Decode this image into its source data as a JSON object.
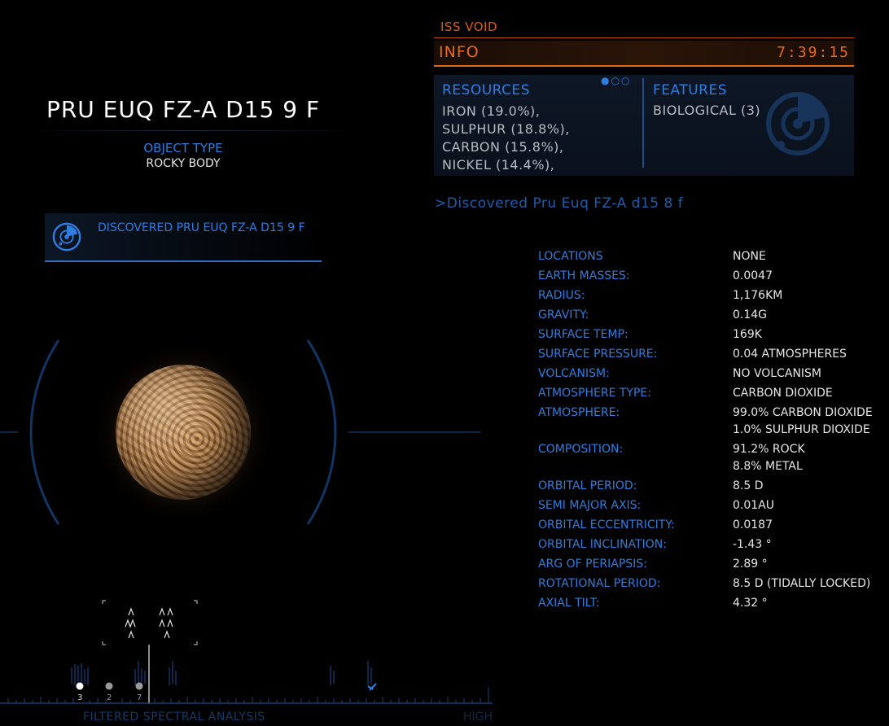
{
  "planet": {
    "name": "PRU EUQ FZ-A D15 9 F",
    "object_type_label": "OBJECT TYPE",
    "object_type_value": "ROCKY BODY"
  },
  "discovered_notice": "DISCOVERED PRU EUQ FZ-A D15 9 F",
  "spectral": {
    "label": "FILTERED SPECTRAL ANALYSIS",
    "high_label": "HIGH",
    "markers": [
      "3",
      "2",
      "7"
    ]
  },
  "header": {
    "ship": "ISS VOID",
    "title": "INFO",
    "time": "7:39:15"
  },
  "info_panel": {
    "resources_title": "RESOURCES",
    "resources": [
      "IRON (19.0%),",
      "SULPHUR (18.8%),",
      "CARBON (15.8%),",
      "NICKEL (14.4%),"
    ],
    "features_title": "FEATURES",
    "features": [
      "BIOLOGICAL (3)"
    ],
    "page_dots": "●○○"
  },
  "message": ">Discovered Pru Euq FZ-A d15 8 f",
  "properties": [
    {
      "label": "LOCATIONS",
      "value": "NONE"
    },
    {
      "label": "EARTH MASSES:",
      "value": "0.0047"
    },
    {
      "label": "RADIUS:",
      "value": "1,176KM"
    },
    {
      "label": "GRAVITY:",
      "value": "0.14G"
    },
    {
      "label": "SURFACE TEMP:",
      "value": "169K"
    },
    {
      "label": "SURFACE PRESSURE:",
      "value": "0.04 ATMOSPHERES"
    },
    {
      "label": "VOLCANISM:",
      "value": "NO VOLCANISM"
    },
    {
      "label": "ATMOSPHERE TYPE:",
      "value": "CARBON DIOXIDE"
    },
    {
      "label": "ATMOSPHERE:",
      "value": "99.0% CARBON DIOXIDE",
      "value2": "1.0% SULPHUR DIOXIDE"
    },
    {
      "label": "COMPOSITION:",
      "value": "91.2% ROCK",
      "value2": "8.8% METAL"
    },
    {
      "label": "ORBITAL PERIOD:",
      "value": "8.5 D"
    },
    {
      "label": "SEMI MAJOR AXIS:",
      "value": "0.01AU"
    },
    {
      "label": "ORBITAL ECCENTRICITY:",
      "value": "0.0187"
    },
    {
      "label": "ORBITAL INCLINATION:",
      "value": "-1.43 °"
    },
    {
      "label": "ARG OF PERIAPSIS:",
      "value": "2.89 °"
    },
    {
      "label": "ROTATIONAL PERIOD:",
      "value": "8.5 D (TIDALLY LOCKED)"
    },
    {
      "label": "AXIAL TILT:",
      "value": "4.32 °"
    }
  ],
  "colors": {
    "accent_blue": "#2f7de1",
    "accent_orange": "#e86a12",
    "text": "#e6e6e6"
  }
}
